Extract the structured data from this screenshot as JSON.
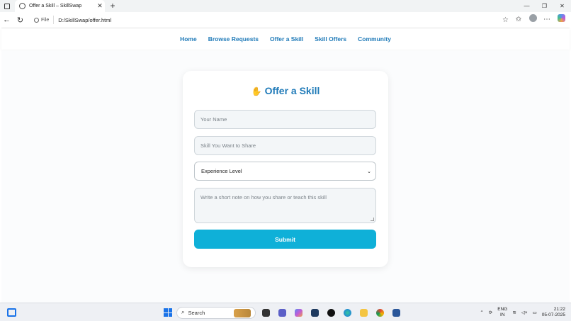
{
  "browser": {
    "tab_title": "Offer a Skill – SkillSwap",
    "url_scheme_label": "File",
    "url": "D:/SkillSwap/offer.html"
  },
  "site_nav": {
    "items": [
      "Home",
      "Browse Requests",
      "Offer a Skill",
      "Skill Offers",
      "Community"
    ]
  },
  "form": {
    "title": "Offer a Skill",
    "name_placeholder": "Your Name",
    "skill_placeholder": "Skill You Want to Share",
    "level_selected": "Experience Level",
    "note_placeholder": "Write a short note on how you share or teach this skill",
    "submit_label": "Submit"
  },
  "taskbar": {
    "search_label": "Search",
    "lang_top": "ENG",
    "lang_bottom": "IN",
    "time": "21:22",
    "date": "05-07-2025"
  },
  "colors": {
    "accent": "#1f7ab8",
    "submit": "#0fb0d8"
  }
}
